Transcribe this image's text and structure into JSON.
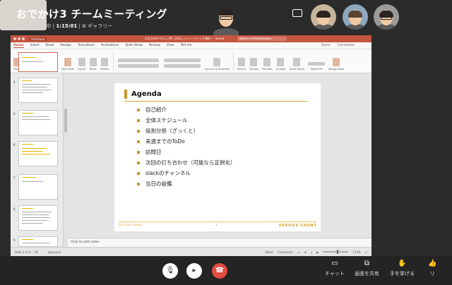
{
  "meeting": {
    "title": "おでかけ3 チームミーティング",
    "participants_text": "5/6 人が通話中 | ",
    "duration": "1:15:01",
    "view_label": "ギャラリー"
  },
  "ppt": {
    "autosave": "AutoSave",
    "filename": "だれかのやりたい_IRF_2022_○○ミーティング資料 — Saved",
    "search": "Search in Presentation",
    "tabs": [
      "Home",
      "Insert",
      "Draw",
      "Design",
      "Transitions",
      "Animations",
      "Slide Show",
      "Review",
      "View",
      "Tell me"
    ],
    "share": "Share",
    "comments_tab": "Comments",
    "ribbon": [
      "Paste",
      "Cut",
      "Copy",
      "Format",
      "New Slide",
      "Layout",
      "Reset",
      "Section",
      "",
      "Convert to SmartArt",
      "Picture",
      "Shapes",
      "Text Box",
      "Arrange",
      "Quick Styles",
      "Shape Fill",
      "Design Ideas"
    ],
    "thumb_numbers": [
      "4",
      "5",
      "6",
      "7",
      "8",
      "9"
    ],
    "slide": {
      "title": "Agenda",
      "items": [
        "自己紹介",
        "全体スケジュール",
        "役割分担（ざっくと）",
        "来週までのToDo",
        "訪問日",
        "次回の打ち合わせ（可能なら定例化）",
        "slackのチャンネル",
        "当日の設備"
      ],
      "footer_left": "Do it pro bono.",
      "footer_center": "1",
      "footer_right": "SERVICE GRANT"
    },
    "notes": "Click to add notes",
    "status": {
      "slide_of": "Slide 1 of 0… 30",
      "language": "Japanese",
      "notes_btn": "Notes",
      "comments_btn": "Comments",
      "zoom": "112%"
    }
  },
  "toolbar": {
    "chat": "チャット",
    "share": "画面を共有",
    "raise": "手を挙げる",
    "react": "リ"
  },
  "colors": {
    "ppt_accent": "#c4553f",
    "slide_gold": "#c9962d",
    "end_call": "#e04b43"
  }
}
